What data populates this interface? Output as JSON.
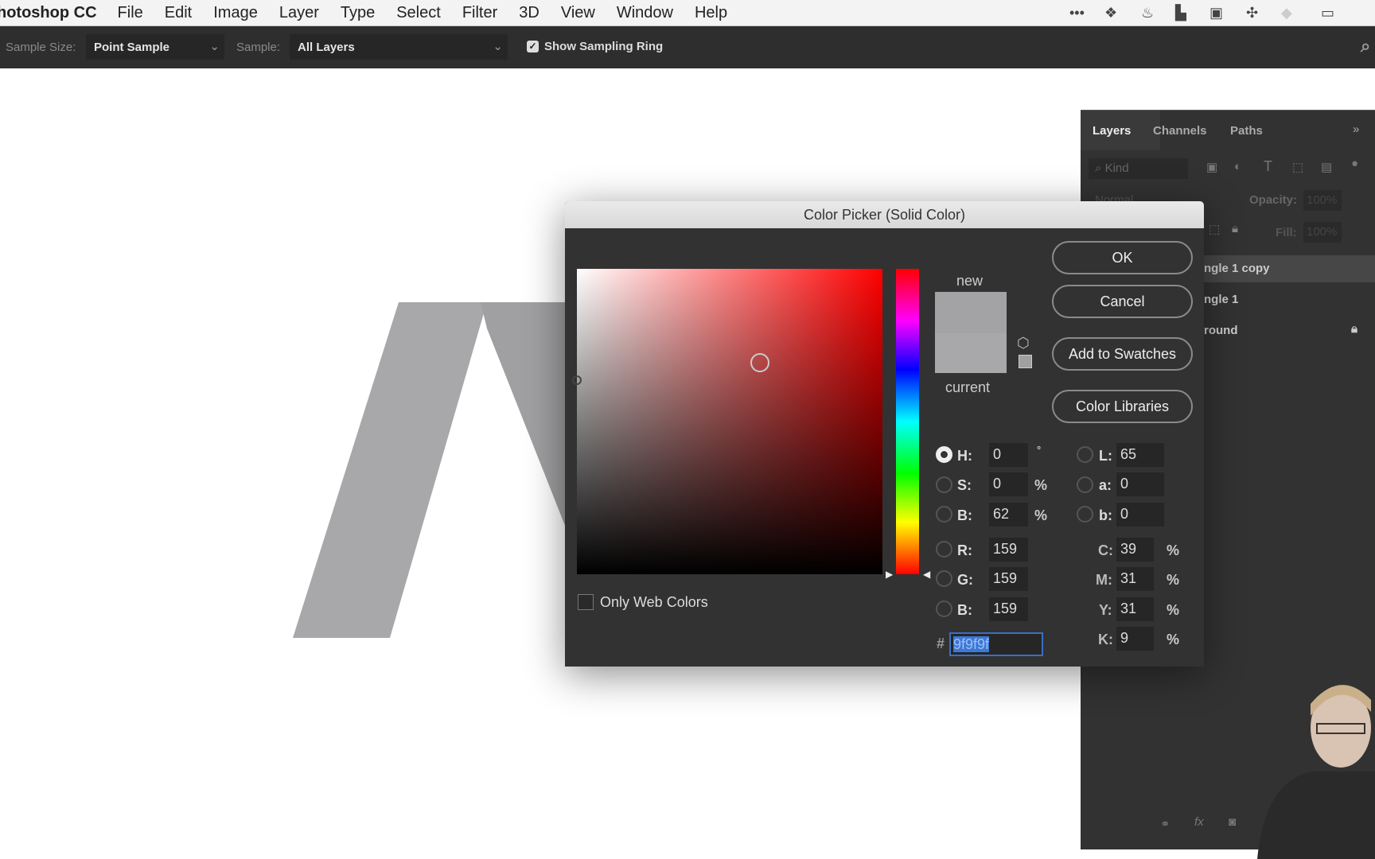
{
  "menubar": {
    "app": "hotoshop CC",
    "items": [
      "File",
      "Edit",
      "Image",
      "Layer",
      "Type",
      "Select",
      "Filter",
      "3D",
      "View",
      "Window",
      "Help"
    ],
    "tray_icons": [
      "more-icon",
      "dropbox-icon",
      "flame-icon",
      "layout-icon",
      "screen-icon",
      "network-icon",
      "wifi-icon",
      "battery-icon"
    ]
  },
  "options": {
    "sample_size_label": "Sample Size:",
    "sample_size_value": "Point Sample",
    "sample_label": "Sample:",
    "sample_value": "All Layers",
    "show_ring_label": "Show Sampling Ring",
    "show_ring_checked": true
  },
  "layers_panel": {
    "tabs": [
      "Layers",
      "Channels",
      "Paths"
    ],
    "kind": "Kind",
    "blend_mode": "Normal",
    "opacity_label": "Opacity:",
    "opacity_value": "100%",
    "fill_label": "Fill:",
    "fill_value": "100%",
    "layers": [
      {
        "name": "ngle 1 copy",
        "selected": true
      },
      {
        "name": "ngle 1"
      },
      {
        "name": "round",
        "locked": true
      }
    ]
  },
  "dialog": {
    "title": "Color Picker (Solid Color)",
    "ok": "OK",
    "cancel": "Cancel",
    "add_swatches": "Add to Swatches",
    "color_libraries": "Color Libraries",
    "new_label": "new",
    "current_label": "current",
    "new_color": "#9f9f9f",
    "current_color": "#a8a8aa",
    "only_web_colors": "Only Web Colors",
    "only_web_checked": false,
    "fields": {
      "H": "0",
      "S": "0",
      "B": "62",
      "R": "159",
      "G": "159",
      "B2": "159",
      "L": "65",
      "a": "0",
      "b": "0",
      "C": "39",
      "M": "31",
      "Y": "31",
      "K": "9"
    },
    "labels": {
      "H": "H:",
      "S": "S:",
      "B": "B:",
      "R": "R:",
      "G": "G:",
      "B2": "B:",
      "L": "L:",
      "a": "a:",
      "b": "b:",
      "C": "C:",
      "M": "M:",
      "Y": "Y:",
      "K": "K:",
      "deg": "°",
      "pct": "%",
      "hash": "#"
    },
    "hex": "9f9f9f",
    "selected_mode": "H"
  },
  "colors": {
    "canvas_shape": "#a8a8aa",
    "accent": "#2f6fd0"
  }
}
